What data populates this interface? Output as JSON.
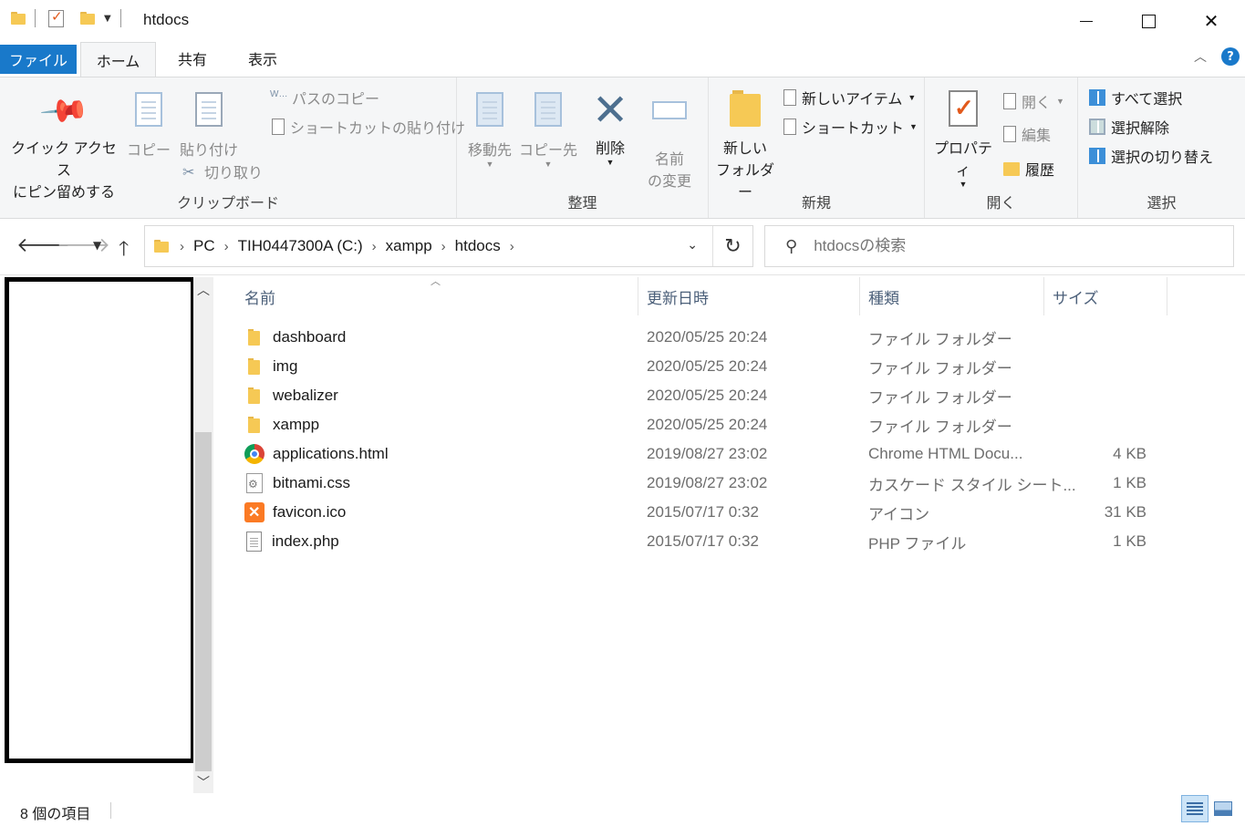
{
  "window": {
    "title": "htdocs",
    "minimize_icon": "minimize-icon",
    "maximize_icon": "maximize-icon",
    "close_icon": "close-icon"
  },
  "ribbon_tabs": {
    "file": "ファイル",
    "home": "ホーム",
    "share": "共有",
    "view": "表示",
    "help": "?"
  },
  "ribbon": {
    "clipboard": {
      "label": "クリップボード",
      "pin_line1": "クイック アクセス",
      "pin_line2": "にピン留めする",
      "copy": "コピー",
      "paste": "貼り付け",
      "copy_path": "パスのコピー",
      "paste_shortcut": "ショートカットの貼り付け",
      "cut": "切り取り"
    },
    "organize": {
      "label": "整理",
      "move_to": "移動先",
      "copy_to": "コピー先",
      "delete": "削除",
      "rename_line1": "名前",
      "rename_line2": "の変更"
    },
    "new": {
      "label": "新規",
      "new_folder_line1": "新しい",
      "new_folder_line2": "フォルダー",
      "new_item": "新しいアイテム",
      "shortcut": "ショートカット"
    },
    "open": {
      "label": "開く",
      "properties": "プロパティ",
      "open": "開く",
      "edit": "編集",
      "history": "履歴"
    },
    "select": {
      "label": "選択",
      "select_all": "すべて選択",
      "select_none": "選択解除",
      "invert": "選択の切り替え"
    }
  },
  "address": {
    "crumbs": [
      "PC",
      "TIH0447300A (C:)",
      "xampp",
      "htdocs"
    ],
    "search_placeholder": "htdocsの検索"
  },
  "columns": {
    "name": "名前",
    "date": "更新日時",
    "type": "種類",
    "size": "サイズ"
  },
  "files": [
    {
      "name": "dashboard",
      "date": "2020/05/25 20:24",
      "type": "ファイル フォルダー",
      "size": "",
      "icon": "folder-icon"
    },
    {
      "name": "img",
      "date": "2020/05/25 20:24",
      "type": "ファイル フォルダー",
      "size": "",
      "icon": "folder-icon"
    },
    {
      "name": "webalizer",
      "date": "2020/05/25 20:24",
      "type": "ファイル フォルダー",
      "size": "",
      "icon": "folder-icon"
    },
    {
      "name": "xampp",
      "date": "2020/05/25 20:24",
      "type": "ファイル フォルダー",
      "size": "",
      "icon": "folder-icon"
    },
    {
      "name": "applications.html",
      "date": "2019/08/27 23:02",
      "type": "Chrome HTML Docu...",
      "size": "4 KB",
      "icon": "chrome-icon"
    },
    {
      "name": "bitnami.css",
      "date": "2019/08/27 23:02",
      "type": "カスケード スタイル シート...",
      "size": "1 KB",
      "icon": "css-file-icon"
    },
    {
      "name": "favicon.ico",
      "date": "2015/07/17 0:32",
      "type": "アイコン",
      "size": "31 KB",
      "icon": "xampp-icon"
    },
    {
      "name": "index.php",
      "date": "2015/07/17 0:32",
      "type": "PHP ファイル",
      "size": "1 KB",
      "icon": "php-file-icon"
    }
  ],
  "status": {
    "item_count": "8 個の項目"
  }
}
